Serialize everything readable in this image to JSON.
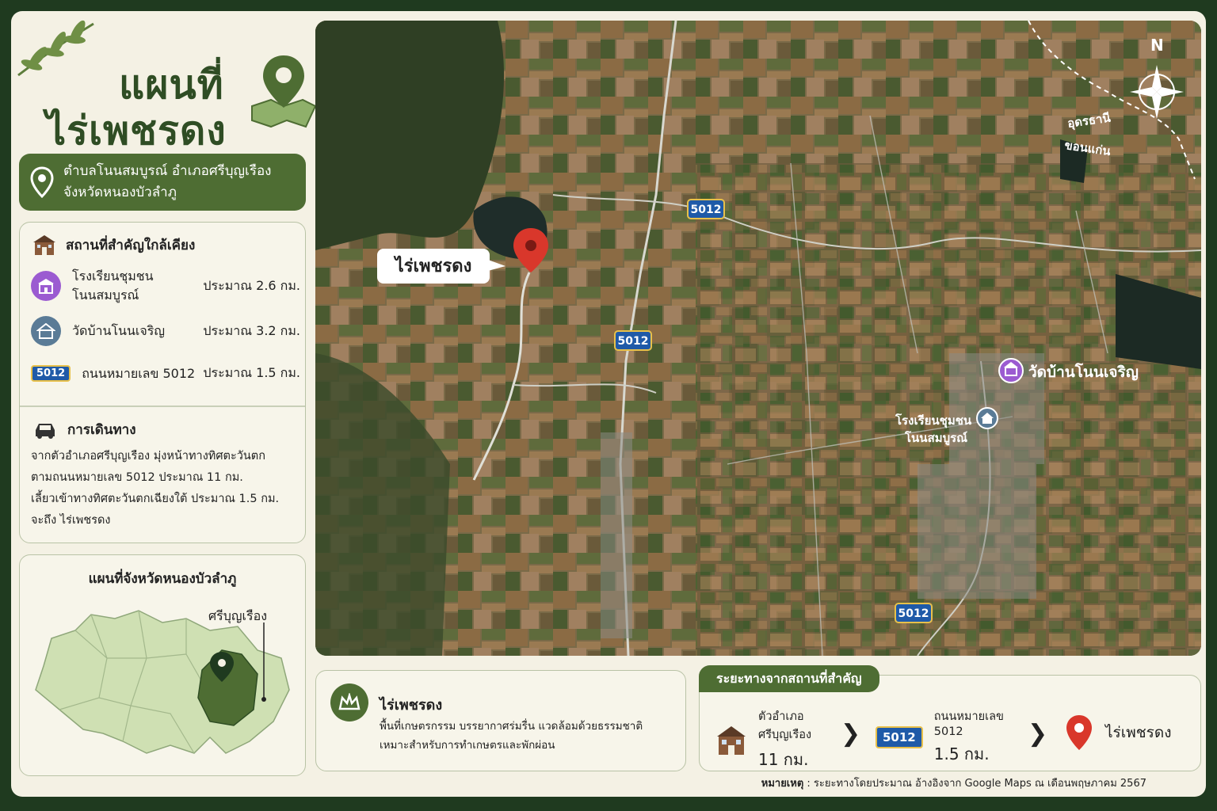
{
  "title": {
    "line1": "แผนที่",
    "line2": "ไร่เพชรดง"
  },
  "address": {
    "line1": "ตำบลโนนสมบูรณ์ อำเภอศรีบุญเรือง",
    "line2": "จังหวัดหนองบัวลำภู"
  },
  "nearby": {
    "heading": "สถานที่สำคัญใกล้เคียง",
    "items": [
      {
        "name_line1": "โรงเรียนชุมชน",
        "name_line2": "โนนสมบูรณ์",
        "distance": "ประมาณ 2.6 กม."
      },
      {
        "name_line1": "วัดบ้านโนนเจริญ",
        "name_line2": "",
        "distance": "ประมาณ 3.2 กม."
      },
      {
        "badge": "5012",
        "name_line1": "ถนนหมายเลข 5012",
        "name_line2": "",
        "distance": "ประมาณ 1.5 กม."
      }
    ]
  },
  "travel": {
    "heading": "การเดินทาง",
    "lines": [
      "จากตัวอำเภอศรีบุญเรือง มุ่งหน้าทางทิศตะวันตก",
      "ตามถนนหมายเลข 5012 ประมาณ 11 กม.",
      "เลี้ยวเข้าทางทิศตะวันตกเฉียงใต้ ประมาณ 1.5 กม.",
      "จะถึง ไร่เพชรดง"
    ]
  },
  "province_map": {
    "title": "แผนที่จังหวัดหนองบัวลำภู",
    "district_label": "ศรีบุญเรือง"
  },
  "map": {
    "compass": "N",
    "farm_label": "ไร่เพชรดง",
    "road_badge": "5012",
    "temple_label": "วัดบ้านโนนเจริญ",
    "school_label_line1": "โรงเรียนชุมชน",
    "school_label_line2": "โนนสมบูรณ์",
    "border_label_1": "อุดรธานี",
    "border_label_2": "ขอนแก่น"
  },
  "info": {
    "title": "ไร่เพชรดง",
    "desc_line1": "พื้นที่เกษตรกรรม บรรยากาศร่มรื่น แวดล้อมด้วยธรรมชาติ",
    "desc_line2": "เหมาะสำหรับการทำเกษตรและพักผ่อน"
  },
  "distance_section": {
    "heading": "ระยะทางจากสถานที่สำคัญ",
    "step1_line1": "ตัวอำเภอ",
    "step1_line2": "ศรีบุญเรือง",
    "step1_value": "11 กม.",
    "step2_badge": "5012",
    "step2_line1": "ถนนหมายเลข",
    "step2_line2": "5012",
    "step2_value": "1.5 กม.",
    "step3_label": "ไร่เพชรดง"
  },
  "note": {
    "label": "หมายเหตุ",
    "text": " : ระยะทางโดยประมาณ อ้างอิงจาก Google Maps ณ เดือนพฤษภาคม 2567"
  },
  "colors": {
    "accent_green": "#4e6d33",
    "pin_red": "#d9372b",
    "badge_blue": "#1f5aa8",
    "temple_purple": "#9b5bd1"
  }
}
